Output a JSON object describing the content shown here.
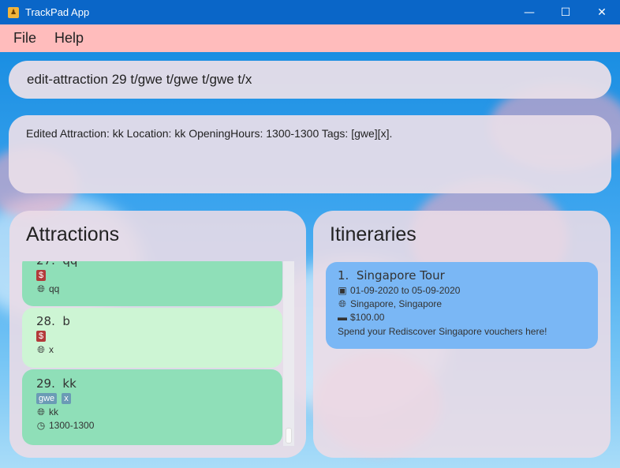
{
  "window": {
    "title": "TrackPad App",
    "minimize_icon": "minimize-icon",
    "maximize_icon": "maximize-icon",
    "close_icon": "close-icon"
  },
  "menu": {
    "items": [
      "File",
      "Help"
    ]
  },
  "command": {
    "value": "edit-attraction 29 t/gwe t/gwe t/gwe t/x"
  },
  "result": {
    "text": "Edited Attraction: kk Location: kk OpeningHours: 1300-1300 Tags: [gwe][x]."
  },
  "attractions": {
    "title": "Attractions",
    "items": [
      {
        "index": "27.",
        "name": "qq",
        "tags": [
          "$"
        ],
        "location": "qq"
      },
      {
        "index": "28.",
        "name": "b",
        "tags": [
          "$"
        ],
        "location": "x"
      },
      {
        "index": "29.",
        "name": "kk",
        "tags": [
          "gwe",
          "x"
        ],
        "location": "kk",
        "hours": "1300-1300"
      }
    ]
  },
  "itineraries": {
    "title": "Itineraries",
    "items": [
      {
        "index": "1.",
        "name": "Singapore Tour",
        "dates": "01-09-2020 to 05-09-2020",
        "location": "Singapore, Singapore",
        "budget": "$100.00",
        "description": "Spend your Rediscover Singapore vouchers here!"
      }
    ]
  },
  "colors": {
    "titlebar": "#0a66c8",
    "menubar": "#ffbcbc",
    "card_green": "#8fdfb8",
    "card_light": "#cdf5d4",
    "itinerary_card": "#7ab7f5",
    "money_tag": "#b33a3a",
    "tag": "#6a9bb5"
  }
}
